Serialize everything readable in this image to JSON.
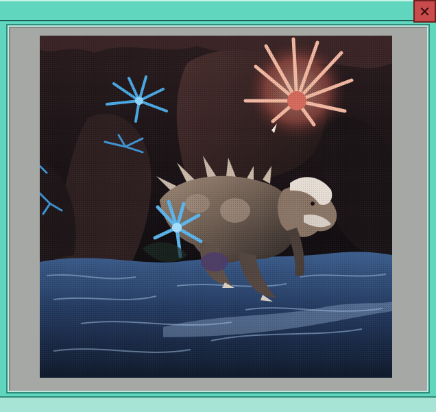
{
  "window": {
    "close_glyph": "✕",
    "close_icon": "close-icon"
  },
  "image": {
    "description_icon": "game-scene-image"
  },
  "colors": {
    "titlebar": "#5fd6bd",
    "close": "#c94b4b",
    "content_bg": "#a6a8a6"
  }
}
